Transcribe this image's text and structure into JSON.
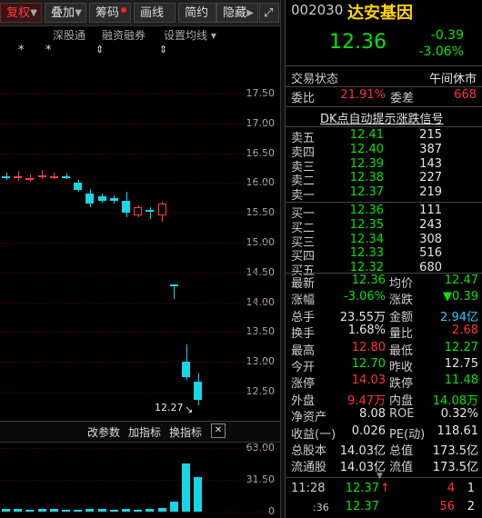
{
  "menu": {
    "items": [
      {
        "label": "复权",
        "caret": "▼",
        "active": true
      },
      {
        "label": "叠加",
        "caret": "▼"
      },
      {
        "label": "筹码",
        "dot": true
      },
      {
        "label": "画线"
      },
      {
        "label": "简约"
      },
      {
        "label": "隐藏",
        "caret": "▶"
      }
    ],
    "expand_icon": "⤢",
    "sub_items": [
      "深股通",
      "融资融券",
      "设置均线 ▾"
    ],
    "markers": [
      "*",
      "*",
      "⇕",
      "⇕"
    ]
  },
  "chart": {
    "price_labels": [
      "17.50",
      "17.00",
      "16.50",
      "16.00",
      "15.50",
      "15.00",
      "14.50",
      "14.00",
      "13.50",
      "13.00",
      "12.50"
    ],
    "low_label": "12.27",
    "candles": [
      {
        "o": 16.1,
        "c": 16.12,
        "h": 16.18,
        "l": 16.05,
        "dir": "down"
      },
      {
        "o": 16.08,
        "c": 16.12,
        "h": 16.2,
        "l": 16.04,
        "dir": "up"
      },
      {
        "o": 16.05,
        "c": 16.08,
        "h": 16.15,
        "l": 16.02,
        "dir": "up"
      },
      {
        "o": 16.1,
        "c": 16.13,
        "h": 16.22,
        "l": 16.06,
        "dir": "up"
      },
      {
        "o": 16.1,
        "c": 16.12,
        "h": 16.18,
        "l": 16.06,
        "dir": "up"
      },
      {
        "o": 16.12,
        "c": 16.1,
        "h": 16.16,
        "l": 16.07,
        "dir": "down"
      },
      {
        "o": 16.0,
        "c": 15.88,
        "h": 16.05,
        "l": 15.85,
        "dir": "down"
      },
      {
        "o": 15.83,
        "c": 15.65,
        "h": 15.9,
        "l": 15.6,
        "dir": "down"
      },
      {
        "o": 15.78,
        "c": 15.7,
        "h": 15.82,
        "l": 15.67,
        "dir": "down"
      },
      {
        "o": 15.75,
        "c": 15.7,
        "h": 15.8,
        "l": 15.66,
        "dir": "down"
      },
      {
        "o": 15.7,
        "c": 15.5,
        "h": 15.85,
        "l": 15.42,
        "dir": "down"
      },
      {
        "o": 15.45,
        "c": 15.6,
        "h": 15.62,
        "l": 15.42,
        "dir": "up"
      },
      {
        "o": 15.55,
        "c": 15.52,
        "h": 15.6,
        "l": 15.4,
        "dir": "down"
      },
      {
        "o": 15.45,
        "c": 15.65,
        "h": 15.68,
        "l": 15.35,
        "dir": "up"
      },
      {
        "o": 14.3,
        "c": 14.28,
        "h": 14.3,
        "l": 14.05,
        "dir": "down"
      },
      {
        "o": 13.0,
        "c": 12.75,
        "h": 13.3,
        "l": 12.7,
        "dir": "down"
      },
      {
        "o": 12.67,
        "c": 12.37,
        "h": 12.8,
        "l": 12.27,
        "dir": "down"
      }
    ],
    "lower_bar": {
      "items": [
        "改参数",
        "加指标",
        "换指标"
      ],
      "close_icon": "✕"
    },
    "vol_labels": [
      "63.00",
      "31.50",
      "0"
    ],
    "volumes": [
      3,
      3,
      2,
      3,
      3,
      2,
      2,
      3,
      3,
      2,
      3,
      2,
      3,
      4,
      10,
      48,
      34
    ]
  },
  "quote": {
    "code": "002030",
    "name": "达安基因",
    "price": "12.36",
    "change": "-0.39",
    "change_pct": "-3.06%",
    "status_label": "交易状态",
    "status_value": "午间休市",
    "weibi_label": "委比",
    "weibi_value": "21.91%",
    "weicha_label": "委差",
    "weicha_value": "668",
    "dk_label": "DK点自动提示涨跌信号",
    "sell": [
      {
        "label": "卖五",
        "price": "12.41",
        "vol": "215"
      },
      {
        "label": "卖四",
        "price": "12.40",
        "vol": "387"
      },
      {
        "label": "卖三",
        "price": "12.39",
        "vol": "143"
      },
      {
        "label": "卖二",
        "price": "12.38",
        "vol": "227"
      },
      {
        "label": "卖一",
        "price": "12.37",
        "vol": "219"
      }
    ],
    "buy": [
      {
        "label": "买一",
        "price": "12.36",
        "vol": "111"
      },
      {
        "label": "买二",
        "price": "12.35",
        "vol": "243"
      },
      {
        "label": "买三",
        "price": "12.34",
        "vol": "308"
      },
      {
        "label": "买四",
        "price": "12.33",
        "vol": "516"
      },
      {
        "label": "买五",
        "price": "12.32",
        "vol": "680"
      }
    ],
    "stats": [
      {
        "l1": "最新",
        "v1": "12.36",
        "c1": "green",
        "l2": "均价",
        "v2": "12.47",
        "c2": "green"
      },
      {
        "l1": "涨幅",
        "v1": "-3.06%",
        "c1": "green",
        "l2": "涨跌",
        "v2": "▼0.39",
        "c2": "green"
      },
      {
        "l1": "总手",
        "v1": "23.55万",
        "c1": "white",
        "l2": "金额",
        "v2": "2.94亿",
        "c2": "cyan"
      },
      {
        "l1": "换手",
        "v1": "1.68%",
        "c1": "white",
        "l2": "量比",
        "v2": "2.68",
        "c2": "red"
      },
      {
        "l1": "最高",
        "v1": "12.80",
        "c1": "red",
        "l2": "最低",
        "v2": "12.27",
        "c2": "green"
      },
      {
        "l1": "今开",
        "v1": "12.70",
        "c1": "green",
        "l2": "昨收",
        "v2": "12.75",
        "c2": "white"
      },
      {
        "l1": "涨停",
        "v1": "14.03",
        "c1": "red",
        "l2": "跌停",
        "v2": "11.48",
        "c2": "green"
      },
      {
        "l1": "外盘",
        "v1": "9.47万",
        "c1": "red",
        "l2": "内盘",
        "v2": "14.08万",
        "c2": "green"
      },
      {
        "l1": "净资产",
        "v1": "8.08",
        "c1": "white",
        "l2": "ROE",
        "v2": "0.32%",
        "c2": "white"
      },
      {
        "l1": "收益(一)",
        "v1": "0.026",
        "c1": "white",
        "l2": "PE(动)",
        "v2": "118.61",
        "c2": "white"
      },
      {
        "l1": "总股本",
        "v1": "14.03亿",
        "c1": "white",
        "l2": "总值",
        "v2": "173.5亿",
        "c2": "white"
      },
      {
        "l1": "流通股",
        "v1": "14.03亿",
        "c1": "white",
        "l2": "流值",
        "v2": "173.5亿",
        "c2": "white"
      }
    ],
    "ticks": [
      {
        "time": "11:28",
        "price": "12.37",
        "arrow": "↑",
        "vol": "4",
        "n": "1"
      },
      {
        "time": ":36",
        "price": "12.37",
        "arrow": "",
        "vol": "56",
        "n": "2"
      }
    ],
    "more_icon": "▼"
  },
  "colors": {
    "up": "#ff4040",
    "down": "#16d6e6",
    "bg": "#000000",
    "grid": "#3a0000"
  }
}
